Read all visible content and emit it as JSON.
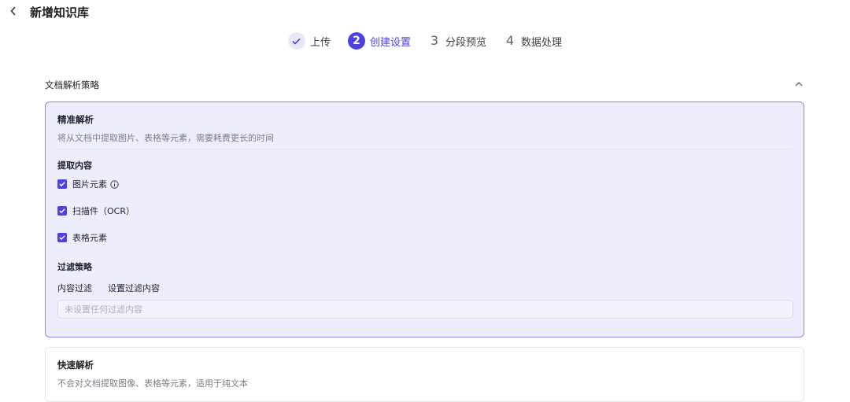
{
  "header": {
    "title": "新增知识库"
  },
  "steps": [
    {
      "label": "上传",
      "status": "done"
    },
    {
      "number": "2",
      "label": "创建设置",
      "status": "active"
    },
    {
      "number": "3",
      "label": "分段预览",
      "status": "todo"
    },
    {
      "number": "4",
      "label": "数据处理",
      "status": "todo"
    }
  ],
  "section": {
    "title": "文档解析策略"
  },
  "precise": {
    "title": "精准解析",
    "description": "将从文档中提取图片、表格等元素，需要耗费更长的时间",
    "extract_title": "提取内容",
    "options": [
      {
        "label": "图片元素",
        "checked": true,
        "info": true
      },
      {
        "label": "扫描件（OCR）",
        "checked": true
      },
      {
        "label": "表格元素",
        "checked": true
      }
    ],
    "filter_title": "过滤策略",
    "filter_label": "内容过滤",
    "filter_link": "设置过滤内容",
    "filter_placeholder": "未设置任何过滤内容"
  },
  "fast": {
    "title": "快速解析",
    "description": "不会对文档提取图像、表格等元素，适用于纯文本"
  },
  "colors": {
    "accent": "#4e40e5",
    "selected_bg": "#eeedfd",
    "selected_border": "#8f88e6"
  }
}
